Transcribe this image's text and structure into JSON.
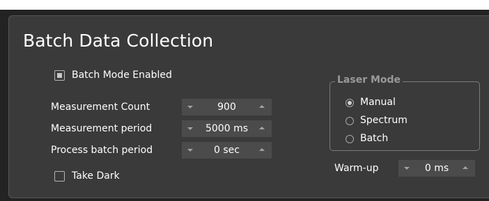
{
  "panel": {
    "title": "Batch Data Collection"
  },
  "batch_mode": {
    "label": "Batch Mode Enabled",
    "checked": true
  },
  "fields": [
    {
      "label": "Measurement Count",
      "value": "900"
    },
    {
      "label": "Measurement period",
      "value": "5000 ms"
    },
    {
      "label": "Process batch period",
      "value": "0 sec"
    }
  ],
  "take_dark": {
    "label": "Take Dark",
    "checked": false
  },
  "laser_mode": {
    "title": "Laser Mode",
    "options": [
      {
        "label": "Manual",
        "selected": true
      },
      {
        "label": "Spectrum",
        "selected": false
      },
      {
        "label": "Batch",
        "selected": false
      }
    ]
  },
  "warmup": {
    "label": "Warm-up",
    "value": "0 ms"
  },
  "colors": {
    "window_background": "#232323",
    "panel_background": "#3a3a3a",
    "spinbox_background": "#4b4b4b",
    "text": "#ffffff",
    "group_title": "#9a9a9a"
  },
  "icons": {
    "spin_down": "triangle-down-icon",
    "spin_up": "triangle-up-icon"
  }
}
